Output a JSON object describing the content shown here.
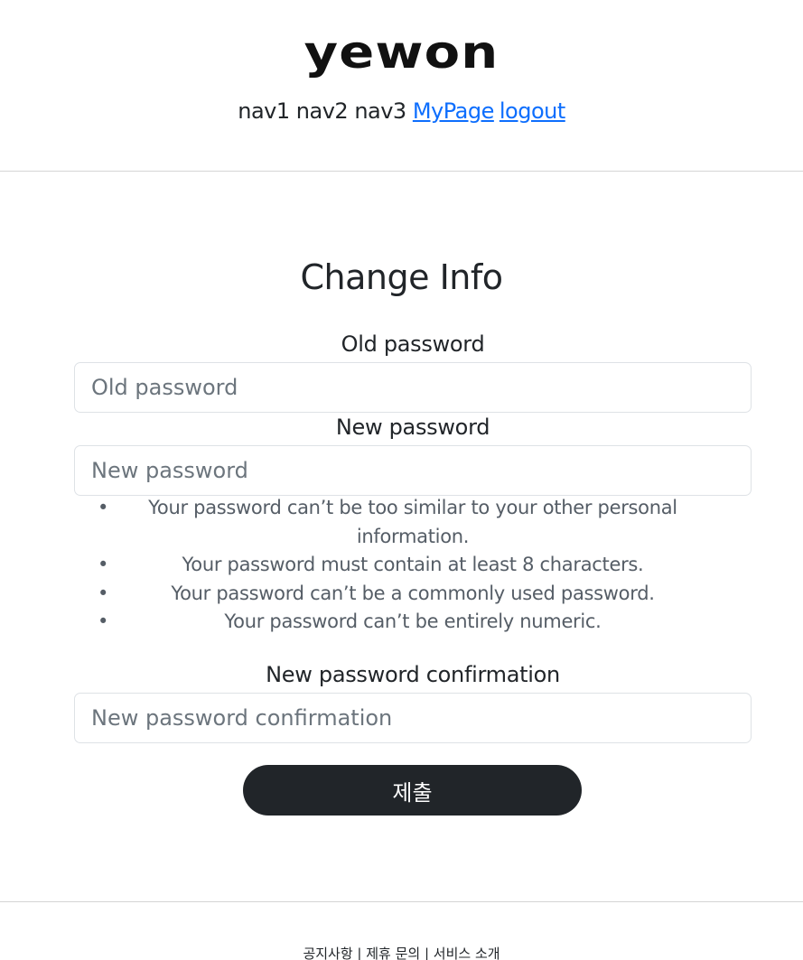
{
  "header": {
    "logo_text": "yewon",
    "nav": {
      "item1": "nav1",
      "item2": "nav2",
      "item3": "nav3",
      "mypage": "MyPage",
      "logout": "logout"
    }
  },
  "form": {
    "title": "Change Info",
    "old_password": {
      "label": "Old password",
      "placeholder": "Old password",
      "value": ""
    },
    "new_password": {
      "label": "New password",
      "placeholder": "New password",
      "value": ""
    },
    "help_text": [
      "Your password can’t be too similar to your other personal information.",
      "Your password must contain at least 8 characters.",
      "Your password can’t be a commonly used password.",
      "Your password can’t be entirely numeric."
    ],
    "confirm_password": {
      "label": "New password confirmation",
      "placeholder": "New password confirmation",
      "value": ""
    },
    "submit_label": "제출"
  },
  "footer": {
    "links_text": "공지사항 | 제휴 문의 | 서비스 소개"
  },
  "colors": {
    "link": "#0d6efd",
    "button_bg": "#212529",
    "button_text": "#ffffff",
    "border": "#dee2e6"
  }
}
